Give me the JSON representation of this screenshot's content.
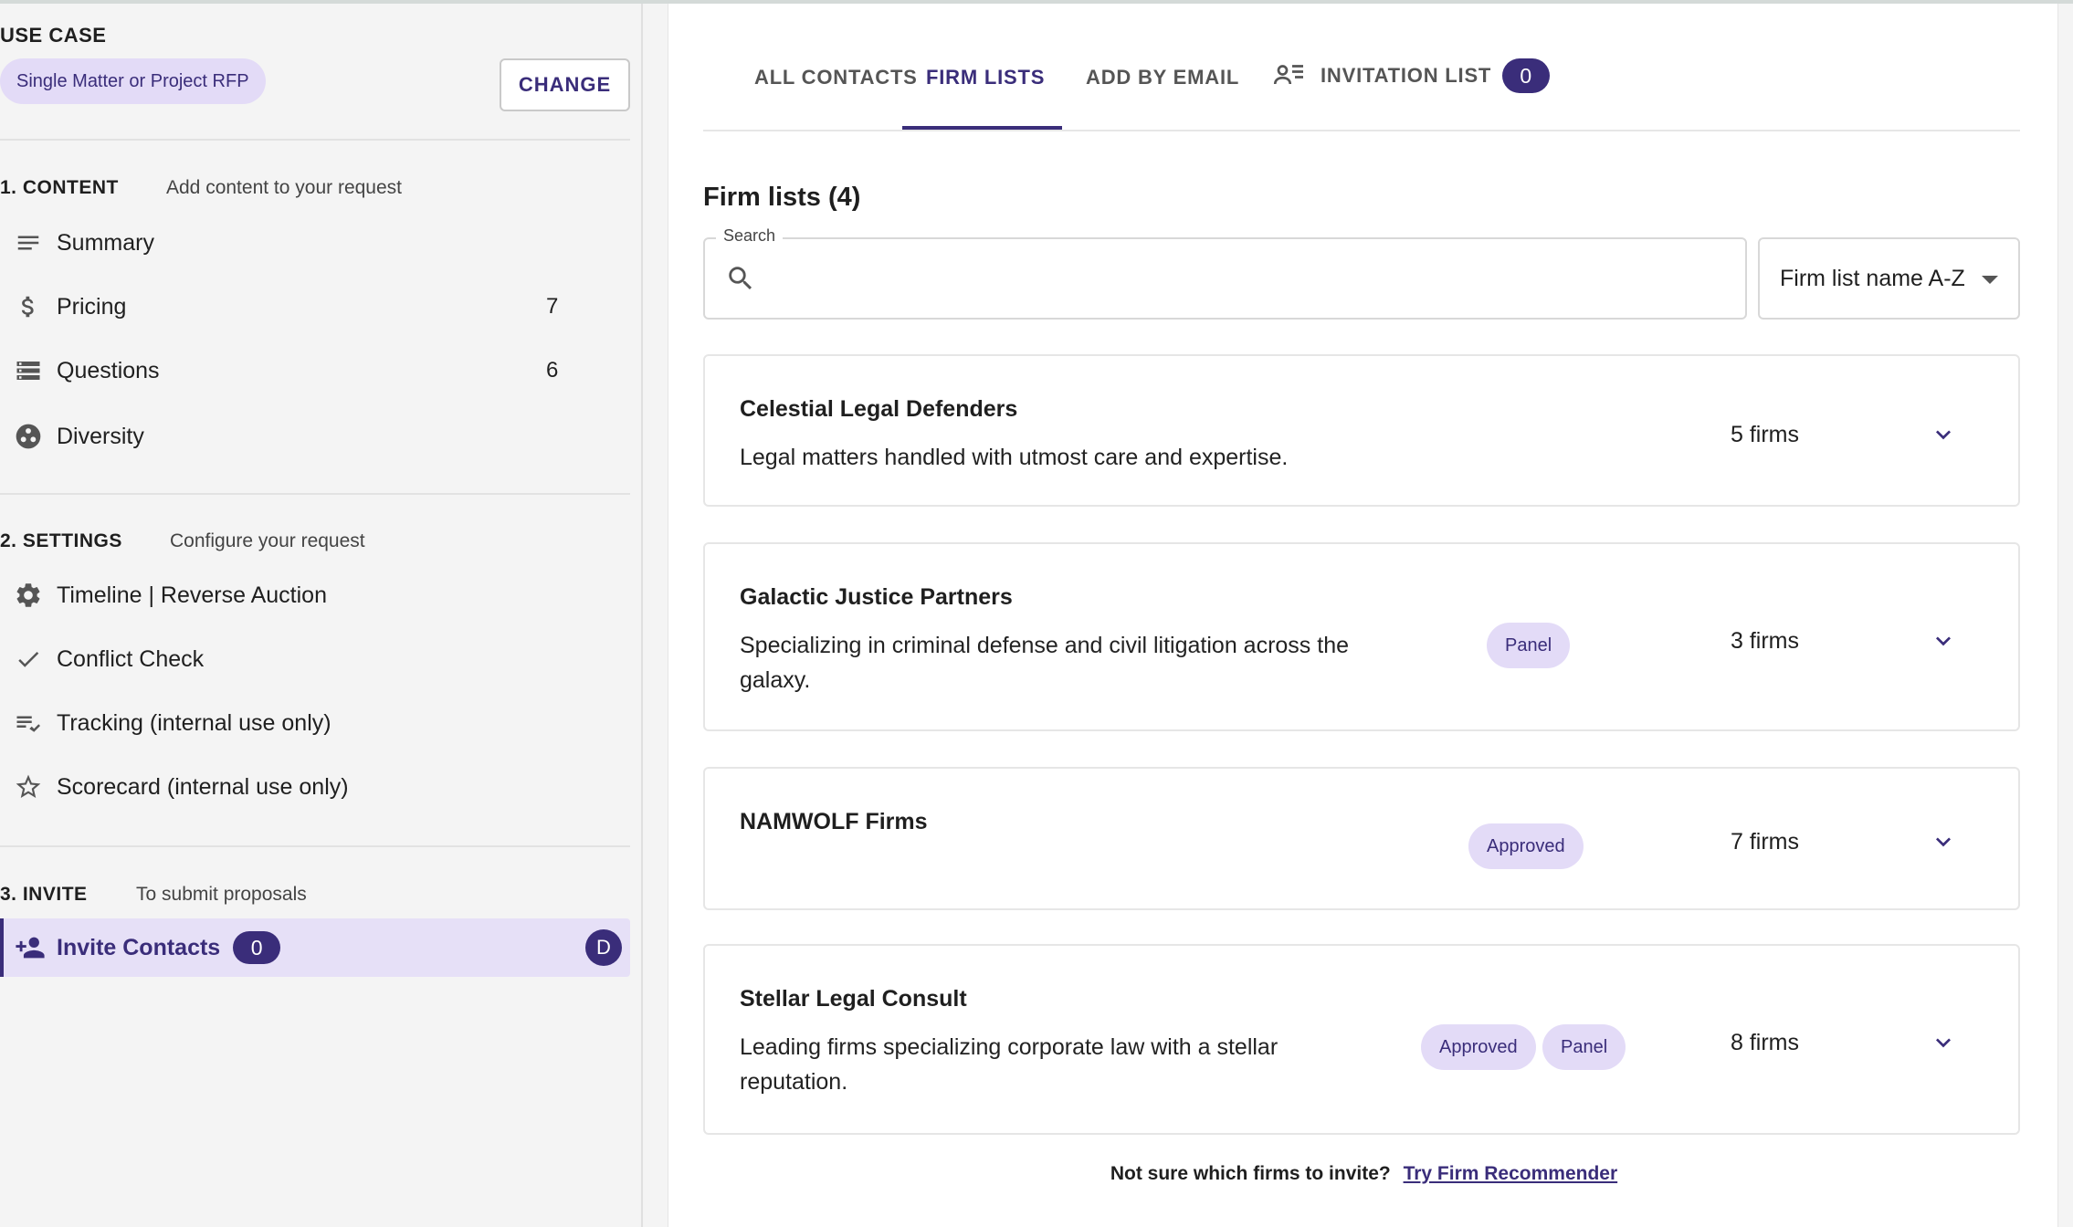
{
  "sidebar": {
    "use_case": {
      "title": "USE CASE",
      "chip": "Single Matter or Project RFP",
      "change_label": "CHANGE"
    },
    "content": {
      "title": "1. CONTENT",
      "subtitle": "Add content to your request",
      "items": [
        {
          "label": "Summary",
          "icon": "lines-icon",
          "count": ""
        },
        {
          "label": "Pricing",
          "icon": "dollar-icon",
          "count": "7"
        },
        {
          "label": "Questions",
          "icon": "storage-icon",
          "count": "6"
        },
        {
          "label": "Diversity",
          "icon": "diversity-icon",
          "count": ""
        }
      ]
    },
    "settings": {
      "title": "2. SETTINGS",
      "subtitle": "Configure your request",
      "items": [
        {
          "label": "Timeline | Reverse Auction",
          "icon": "gear-icon"
        },
        {
          "label": "Conflict Check",
          "icon": "check-icon"
        },
        {
          "label": "Tracking (internal use only)",
          "icon": "checklist-icon"
        },
        {
          "label": "Scorecard (internal use only)",
          "icon": "star-icon"
        }
      ]
    },
    "invite": {
      "title": "3. INVITE",
      "subtitle": "To submit proposals",
      "item": {
        "label": "Invite Contacts",
        "icon": "add-person-icon",
        "count": "0",
        "avatar": "D"
      }
    }
  },
  "main": {
    "tabs": [
      {
        "label": "ALL CONTACTS",
        "active": false
      },
      {
        "label": "FIRM LISTS",
        "active": true
      },
      {
        "label": "ADD BY EMAIL",
        "active": false
      },
      {
        "label": "INVITATION LIST",
        "active": false,
        "count": "0",
        "icon": "person-list-icon"
      }
    ],
    "heading": "Firm lists (4)",
    "search": {
      "label": "Search",
      "value": "",
      "placeholder": ""
    },
    "sort": {
      "selected": "Firm list name A-Z"
    },
    "firm_lists": [
      {
        "name": "Celestial Legal Defenders",
        "description": "Legal matters handled with utmost care and expertise.",
        "tags": [],
        "firms": "5 firms"
      },
      {
        "name": "Galactic Justice Partners",
        "description_line1": "Specializing in criminal defense and civil litigation across the",
        "description_line2": "galaxy.",
        "tags": [
          "Panel"
        ],
        "firms": "3 firms"
      },
      {
        "name": "NAMWOLF Firms",
        "description": "",
        "tags": [
          "Approved"
        ],
        "firms": "7 firms"
      },
      {
        "name": "Stellar Legal Consult",
        "description_line1": "Leading firms specializing corporate law with a stellar",
        "description_line2": "reputation.",
        "tags": [
          "Approved",
          "Panel"
        ],
        "firms": "8 firms"
      }
    ],
    "footer": {
      "text": "Not sure which firms to invite?",
      "link": "Try Firm Recommender"
    }
  },
  "colors": {
    "accent": "#3a2d7a",
    "chip_bg": "#e3dbf7",
    "sidebar_bg": "#f4f4f4"
  }
}
